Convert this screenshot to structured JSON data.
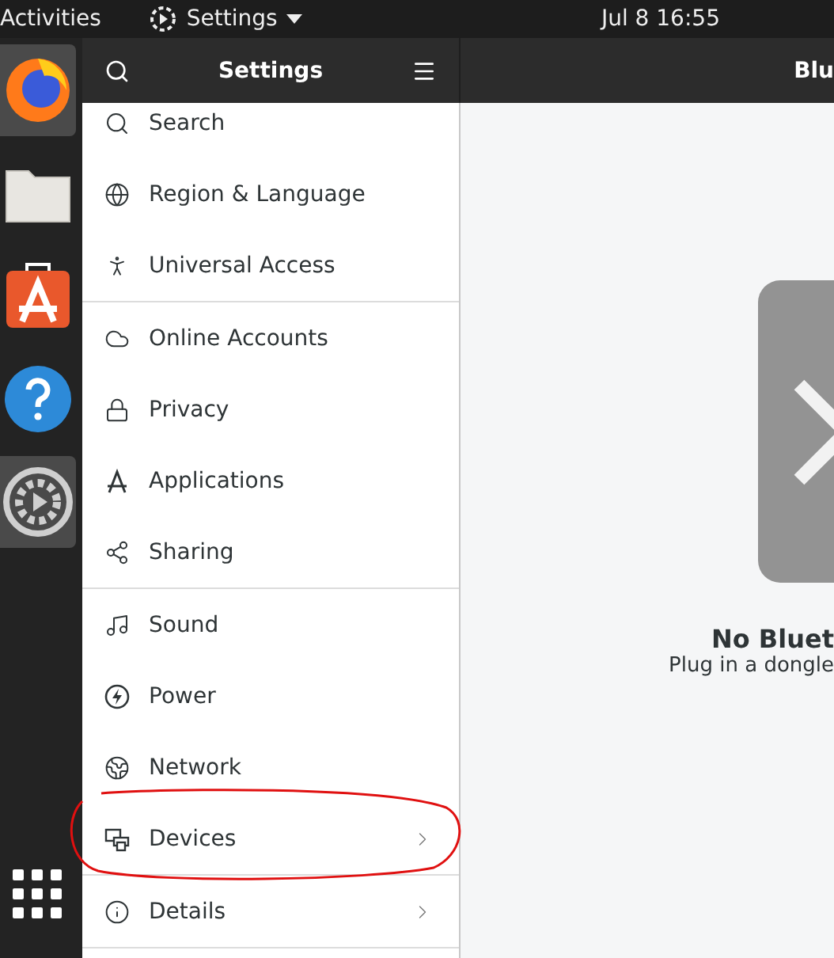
{
  "top_bar": {
    "activities": "Activities",
    "app_menu": "Settings",
    "clock": "Jul 8  16:55"
  },
  "dock": [
    {
      "selected": true
    },
    {
      "selected": false
    },
    {
      "selected": false
    },
    {
      "selected": false
    },
    {
      "selected": true
    },
    {
      "selected": false
    }
  ],
  "sidebar": {
    "title": "Settings",
    "sections": [
      [
        {
          "label": "Search",
          "chevron": false
        },
        {
          "label": "Region & Language",
          "chevron": false
        },
        {
          "label": "Universal Access",
          "chevron": false
        }
      ],
      [
        {
          "label": "Online Accounts",
          "chevron": false
        },
        {
          "label": "Privacy",
          "chevron": false
        },
        {
          "label": "Applications",
          "chevron": false
        },
        {
          "label": "Sharing",
          "chevron": false
        }
      ],
      [
        {
          "label": "Sound",
          "chevron": false
        },
        {
          "label": "Power",
          "chevron": false
        },
        {
          "label": "Network",
          "chevron": false
        },
        {
          "label": "Devices",
          "chevron": true
        }
      ],
      [
        {
          "label": "Details",
          "chevron": true
        }
      ]
    ]
  },
  "content": {
    "title": "Blu",
    "heading": "No Bluet",
    "message": "Plug in a dongle"
  }
}
